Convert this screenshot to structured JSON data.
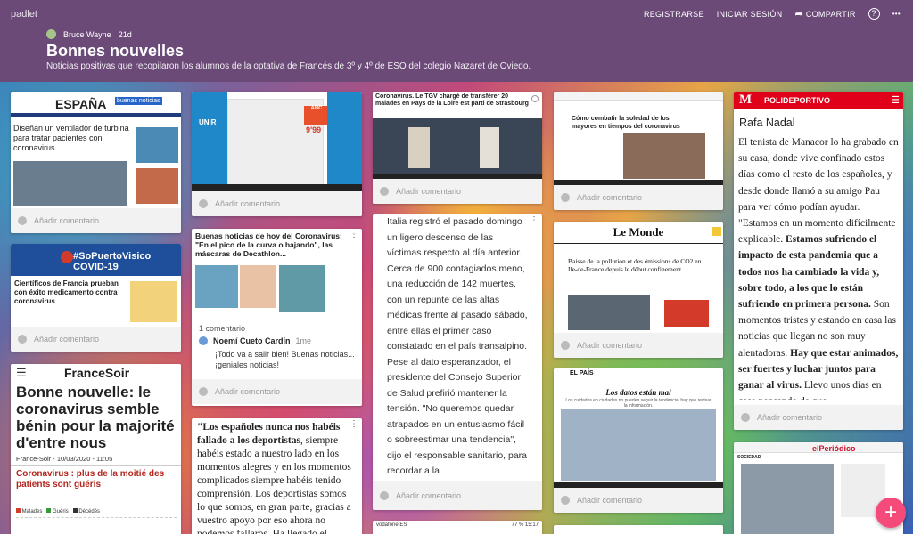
{
  "header": {
    "logo": "padlet",
    "nav": {
      "register": "REGISTRARSE",
      "login": "INICIAR SESIÓN",
      "share": "COMPARTIR",
      "help_icon": "?",
      "more_icon": "•••"
    },
    "author": "Bruce Wayne",
    "age": "21d",
    "title": "Bonnes nouvelles",
    "description": "Noticias positivas que recopilaron los alumnos de la optativa de Francés de 3º y 4º de ESO del colegio Nazaret de Oviedo."
  },
  "common": {
    "add_comment": "Añadir comentario"
  },
  "col1": {
    "c1": {
      "brand": "ESPAÑA",
      "brand2": "buenas noticias",
      "headline": "Diseñan un ventilador de turbina para tratar pacientes con coronavirus"
    },
    "c2": {
      "banner": "#SoPuertoVisico COVID-19",
      "headline": "Científicos de Francia prueban con éxito medicamento contra coronavirus"
    },
    "c3": {
      "brand": "FranceSoir",
      "headline": "Bonne nouvelle: le coronavirus semble bénin pour la majorité d'entre nous",
      "byline": "France-Soir - 10/03/2020 - 11:05",
      "sub": "Coronavirus : plus de la moitié des patients sont guéris",
      "legend1": "Malades",
      "legend2": "Guéris",
      "legend3": "Décédés"
    }
  },
  "col2": {
    "c1": {
      "brand": "UNIR",
      "label2": "ABC",
      "price": "9'99"
    },
    "c2": {
      "title": "Buenas noticias de hoy del Coronavirus: \"En el pico de la curva o bajando\", las máscaras de Decathlon...",
      "comment_count": "1 comentario",
      "comment_author": "Noemí Cueto Cardín",
      "comment_time": "1me",
      "comment_text": "¡Todo va a salir bien! Buenas noticias... ¡geniales noticias!"
    },
    "c3": {
      "quote_bold": "\"Los españoles nunca nos habéis fallado a los deportistas",
      "quote_rest": ", siempre habéis estado a nuestro lado en los momentos alegres y en los momentos complicados siempre habéis tenido comprensión. Los deportistas somos lo que somos, en gran parte, gracias a vuestro apoyo por eso ahora no podemos fallaros. Ha llegado el momento de ..."
    }
  },
  "col3": {
    "c1": {
      "headline": "Coronavirus. Le TGV chargé de transférer 20 malades en Pays de la Loire est parti de Strasbourg"
    },
    "c2": {
      "text": "Italia registró el pasado domingo un ligero descenso de las víctimas respecto al día anterior. Cerca de 900 contagiados meno, una reducción de 142 muertes, con un repunte de las altas médicas frente al pasado sábado, entre ellas el primer caso constatado en el país transalpino. Pese al dato esperanzador, el presidente del Consejo Superior de Salud prefirió mantener la tensión. \"No queremos quedar atrapados en un entusiasmo fácil o sobreestimar una tendencia\", dijo el responsable sanitario, para recordar a la"
    },
    "c3": {
      "status": "vodafone ES",
      "time": "15:17",
      "battery": "77 %"
    }
  },
  "col4": {
    "c1": {
      "headline": "Cómo combatir la soledad de los mayores en tiempos del coronavirus"
    },
    "c2": {
      "brand": "Le Monde",
      "headline": "Baisse de la pollution et des émissions de CO2 en Ile-de-France depuis le début confinement"
    },
    "c3": {
      "brand": "EL PAÍS",
      "headline": "Los datos están mal",
      "sub": "Los cuidados en ciudades no pueden seguir la tendencia, hay que revisar la información."
    }
  },
  "col5": {
    "c1": {
      "brand": "M",
      "section": "POLIDEPORTIVO",
      "title": "Rafa Nadal",
      "text_a": "El tenista de Manacor lo ha grabado en su casa, donde vive confinado estos días como el resto de los españoles, y desde donde llamó a su amigo Pau para ver cómo podían ayudar. \"Estamos en un momento difícilmente explicable. ",
      "text_b": "Estamos sufriendo el impacto de esta pandemia que a todos nos ha cambiado la vida y, sobre todo, a los que lo están sufriendo en primera persona.",
      "text_c": " Son momentos tristes y estando en casa las noticias que llegan no son muy alentadoras. ",
      "text_d": "Hay que estar animados, ser fuertes y luchar juntos para ganar al virus.",
      "text_e": " Llevo unos días en casa pensando de que"
    },
    "c2": {
      "brand": "elPeriódico",
      "section": "SOCIEDAD"
    }
  },
  "fab": "+"
}
